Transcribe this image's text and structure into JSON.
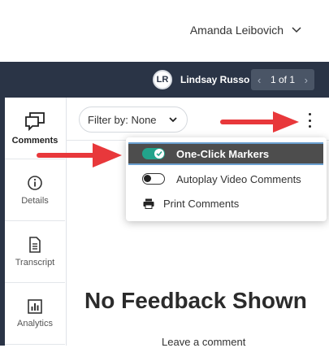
{
  "account": {
    "name": "Amanda Leibovich"
  },
  "header": {
    "avatar_initials": "LR",
    "reviewer_name": "Lindsay Russo",
    "pager_text": "1 of 1"
  },
  "sidebar": {
    "items": [
      {
        "label": "Comments",
        "icon": "comments-icon",
        "active": true
      },
      {
        "label": "Details",
        "icon": "info-icon"
      },
      {
        "label": "Transcript",
        "icon": "document-icon"
      },
      {
        "label": "Analytics",
        "icon": "chart-icon"
      }
    ]
  },
  "filter": {
    "label": "Filter by: None"
  },
  "menu": {
    "items": [
      {
        "label": "One-Click Markers",
        "type": "toggle",
        "state": "on",
        "highlighted": true
      },
      {
        "label": "Autoplay Video Comments",
        "type": "toggle",
        "state": "off"
      },
      {
        "label": "Print Comments",
        "type": "action",
        "icon": "printer-icon"
      }
    ]
  },
  "empty_state": {
    "title": "No Feedback Shown",
    "subtitle": "Leave a comment"
  },
  "colors": {
    "header_bg": "#2a3446",
    "toggle_on": "#22a38b",
    "highlight_bg": "#4d4d4d",
    "annotation_arrow": "#e8383b"
  }
}
